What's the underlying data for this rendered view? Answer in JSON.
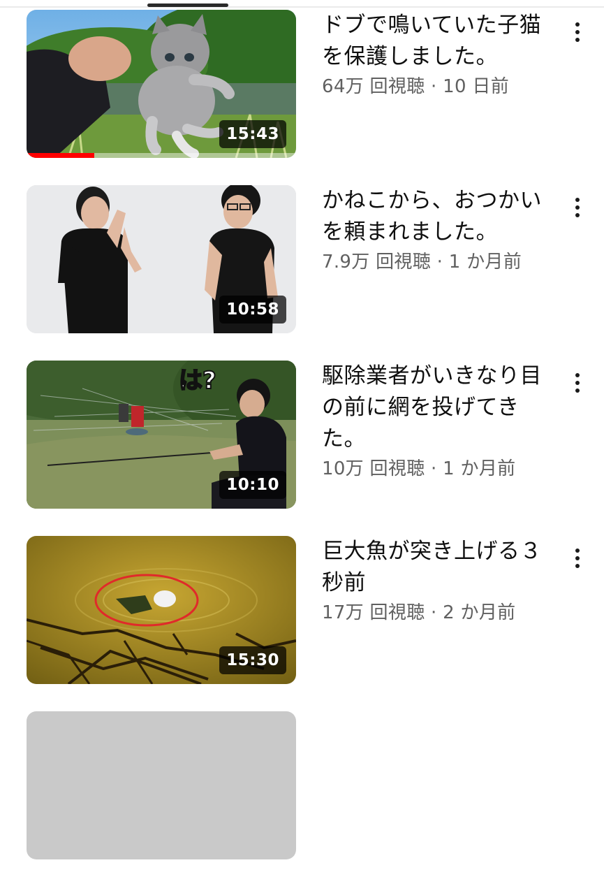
{
  "colors": {
    "accent": "#ff0000",
    "title_text": "#0f0f0f",
    "meta_text": "#606060",
    "duration_bg": "#000000"
  },
  "icons": {
    "more": "more-vert-icon"
  },
  "videos": [
    {
      "title": "ドブで鳴いていた子猫を保護しました。",
      "views": "64万 回視聴",
      "age": "10 日前",
      "stats": "64万 回視聴 · 10 日前",
      "duration": "15:43",
      "watch_progress": 0.25
    },
    {
      "title": "かねこから、おつかいを頼まれました。",
      "views": "7.9万 回視聴",
      "age": "1 か月前",
      "stats": "7.9万 回視聴 · 1 か月前",
      "duration": "10:58"
    },
    {
      "title": "駆除業者がいきなり目の前に網を投げてきた。",
      "views": "10万 回視聴",
      "age": "1 か月前",
      "stats": "10万 回視聴 · 1 か月前",
      "duration": "10:10",
      "thumbnail_text": "は?"
    },
    {
      "title": "巨大魚が突き上げる３秒前",
      "views": "17万 回視聴",
      "age": "2 か月前",
      "stats": "17万 回視聴 · 2 か月前",
      "duration": "15:30"
    }
  ]
}
